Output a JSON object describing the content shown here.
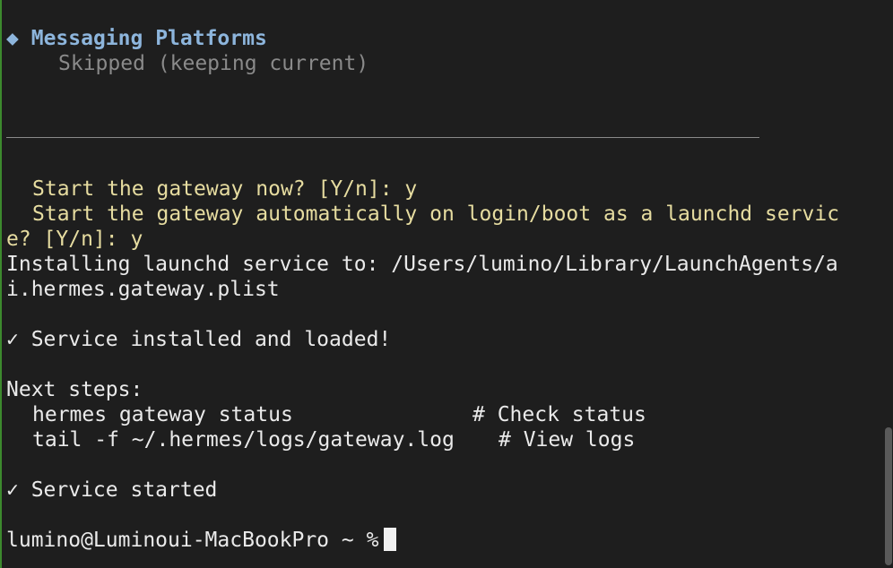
{
  "terminal": {
    "section_marker": "◆",
    "section_title": "Messaging Platforms",
    "section_status": "Skipped (keeping current)",
    "prompt_start_now": "Start the gateway now? [Y/n]: y",
    "prompt_autostart_line1": "Start the gateway automatically on login/boot as a launchd servic",
    "prompt_autostart_line2": "e? [Y/n]: y",
    "install_line1": "Installing launchd service to: /Users/lumino/Library/LaunchAgents/a",
    "install_line2": "i.hermes.gateway.plist",
    "service_installed": "✓ Service installed and loaded!",
    "next_steps_heading": "Next steps:",
    "step1_command": "hermes gateway status",
    "step1_comment": "# Check status",
    "step2_command": "tail -f ~/.hermes/logs/gateway.log",
    "step2_comment": "# View logs",
    "service_started": "✓ Service started",
    "shell_prompt": "lumino@Luminoui-MacBookPro ~ %"
  }
}
